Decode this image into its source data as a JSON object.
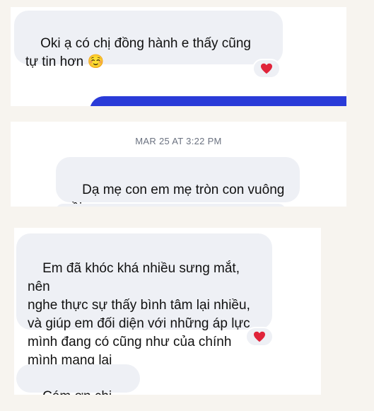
{
  "colors": {
    "page_background": "#f7f4ef",
    "panel_background": "#ffffff",
    "bubble_received": "#eef0f5",
    "bubble_sent": "#2a3bd8",
    "heart": "#e0243a",
    "timestamp_text": "#6b7280"
  },
  "panel1": {
    "message": "Oki ạ có chị đồng hành e thấy cũng\ntự tin hơn ☺️",
    "reaction_icon": "heart-icon"
  },
  "panel2": {
    "timestamp": "MAR 25 AT 3:22 PM",
    "message": "Dạ mẹ con em mẹ tròn con vuông rồi\nnha chị"
  },
  "panel3": {
    "message1": "Em đã khóc khá nhiều sưng mắt, nên\nnghe thực sự thấy bình tâm lại nhiều,\nvà giúp em đối diện với những áp lực\nmình đang có cũng như của chính\nmình mang lại",
    "reaction_icon": "heart-icon",
    "message2": "Cám ơn chị Linh"
  }
}
